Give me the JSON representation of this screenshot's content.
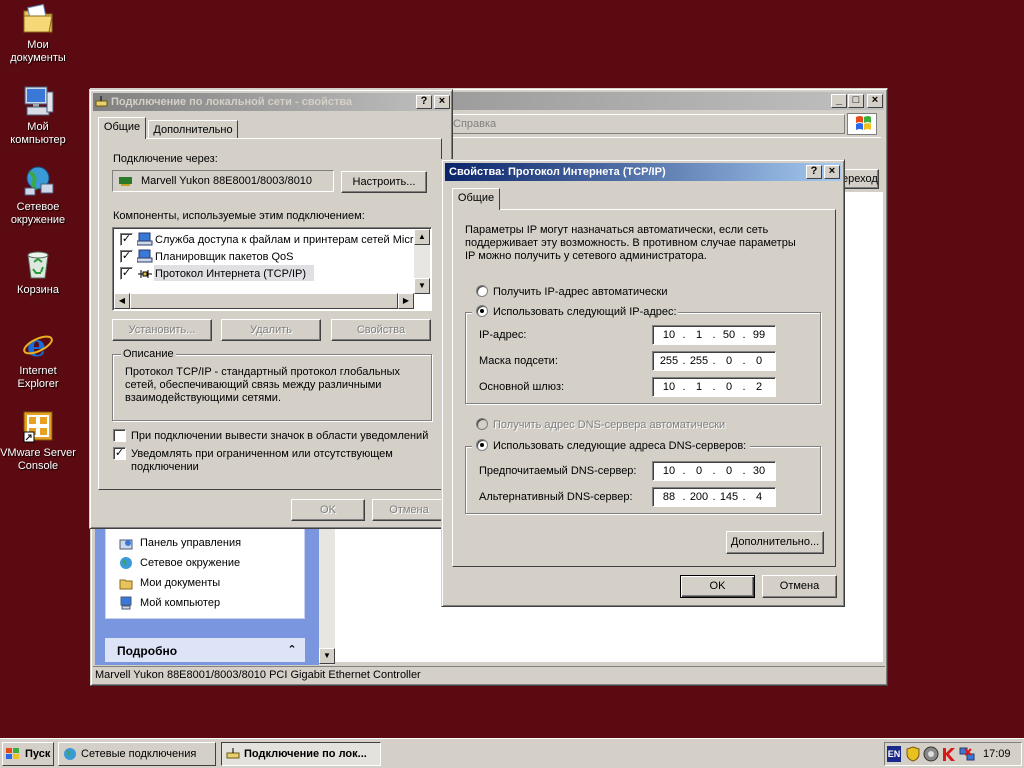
{
  "desktop": {
    "icons": [
      {
        "label1": "Мои",
        "label2": "документы"
      },
      {
        "label1": "Мой",
        "label2": "компьютер"
      },
      {
        "label1": "Сетевое",
        "label2": "окружение"
      },
      {
        "label1": "Корзина",
        "label2": ""
      },
      {
        "label1": "Internet",
        "label2": "Explorer"
      },
      {
        "label1": "VMware Server",
        "label2": "Console"
      }
    ]
  },
  "explorer": {
    "menu_help": "Справка",
    "go_label": "Переход",
    "links": [
      "Панель управления",
      "Сетевое окружение",
      "Мои документы",
      "Мой компьютер"
    ],
    "details_header": "Подробно",
    "status": "Marvell Yukon 88E8001/8003/8010 PCI Gigabit Ethernet Controller"
  },
  "lan": {
    "title": "Подключение по локальной сети - свойства",
    "tabs": [
      "Общие",
      "Дополнительно"
    ],
    "connect_via_label": "Подключение через:",
    "adapter": "Marvell Yukon 88E8001/8003/8010",
    "configure_btn": "Настроить...",
    "components_label": "Компоненты, используемые этим подключением:",
    "components": [
      {
        "label": "Служба доступа к файлам и принтерам сетей Micro"
      },
      {
        "label": "Планировщик пакетов QoS"
      },
      {
        "label": "Протокол Интернета (TCP/IP)"
      }
    ],
    "install_btn": "Установить...",
    "remove_btn": "Удалить",
    "props_btn": "Свойства",
    "desc_legend": "Описание",
    "desc_text": "Протокол TCP/IP - стандартный протокол глобальных сетей, обеспечивающий связь между различными взаимодействующими сетями.",
    "show_icon_label": "При подключении вывести значок в области уведомлений",
    "notify_label1": "Уведомлять при ограниченном или отсутствующем",
    "notify_label2": "подключении",
    "ok": "OK",
    "cancel": "Отмена"
  },
  "tcpip": {
    "title": "Свойства: Протокол Интернета (TCP/IP)",
    "tab": "Общие",
    "intro1": "Параметры IP могут назначаться автоматически, если сеть",
    "intro2": "поддерживает эту возможность. В противном случае параметры",
    "intro3": "IP можно получить у сетевого администратора.",
    "auto_ip": "Получить IP-адрес автоматически",
    "manual_ip": "Использовать следующий IP-адрес:",
    "ip_label": "IP-адрес:",
    "ip": [
      "10",
      "1",
      "50",
      "99"
    ],
    "mask_label": "Маска подсети:",
    "mask": [
      "255",
      "255",
      "0",
      "0"
    ],
    "gw_label": "Основной шлюз:",
    "gw": [
      "10",
      "1",
      "0",
      "2"
    ],
    "auto_dns": "Получить адрес DNS-сервера автоматически",
    "manual_dns": "Использовать следующие адреса DNS-серверов:",
    "dns1_label": "Предпочитаемый DNS-сервер:",
    "dns1": [
      "10",
      "0",
      "0",
      "30"
    ],
    "dns2_label": "Альтернативный DNS-сервер:",
    "dns2": [
      "88",
      "200",
      "145",
      "4"
    ],
    "advanced_btn": "Дополнительно...",
    "ok": "OK",
    "cancel": "Отмена"
  },
  "taskbar": {
    "start": "Пуск",
    "items": [
      "Сетевые подключения",
      "Подключение по лок..."
    ],
    "lang": "EN",
    "clock": "17:09"
  }
}
